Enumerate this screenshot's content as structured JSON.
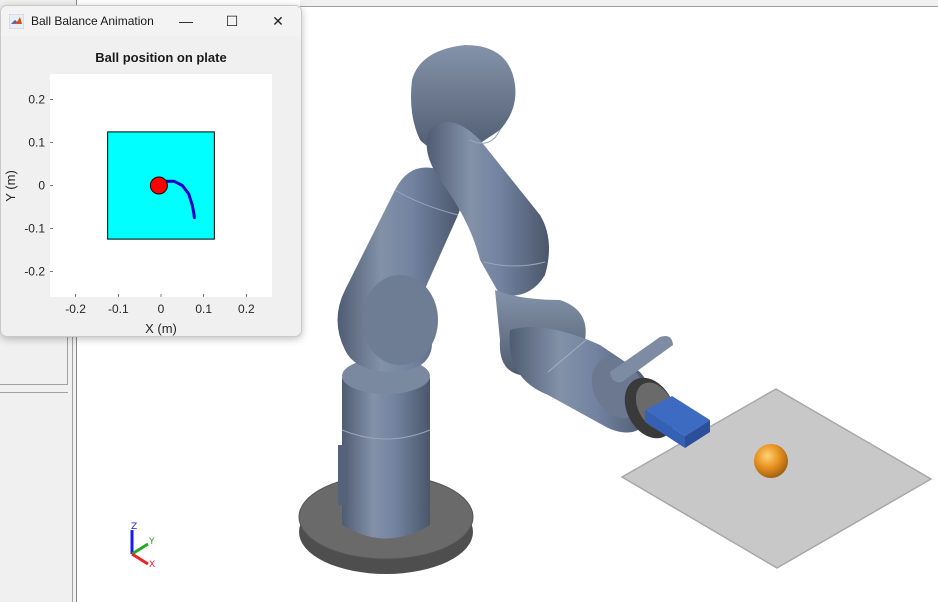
{
  "figure_window": {
    "title": "Ball Balance Animation",
    "icon": "matlab-icon",
    "controls": {
      "minimize": "—",
      "maximize": "☐",
      "close": "✕"
    }
  },
  "chart_data": {
    "type": "scatter",
    "title": "Ball position on plate",
    "xlabel": "X (m)",
    "ylabel": "Y (m)",
    "xlim": [
      -0.26,
      0.26
    ],
    "ylim": [
      -0.26,
      0.26
    ],
    "xticks": [
      -0.2,
      -0.1,
      0,
      0.1,
      0.2
    ],
    "yticks": [
      -0.2,
      -0.1,
      0,
      0.1,
      0.2
    ],
    "xtick_labels": [
      "-0.2",
      "-0.1",
      "0",
      "0.1",
      "0.2"
    ],
    "ytick_labels": [
      "-0.2",
      "-0.1",
      "0",
      "0.1",
      "0.2"
    ],
    "plate": {
      "x": [
        -0.125,
        0.125
      ],
      "y": [
        -0.125,
        0.125
      ],
      "color": "#00ffff"
    },
    "series": [
      {
        "x": [
          -0.005,
          0.01,
          0.03,
          0.05,
          0.065,
          0.073,
          0.077,
          0.078
        ],
        "y": [
          0.0,
          0.01,
          0.01,
          0.0,
          -0.02,
          -0.045,
          -0.065,
          -0.075
        ],
        "color": "#0000cc"
      }
    ],
    "ball": {
      "x": -0.005,
      "y": 0.0,
      "color": "#ff0000"
    },
    "grid": false
  },
  "triad": {
    "z": "Z",
    "y": "Y",
    "x": "X"
  },
  "colors": {
    "robot": "#6f7d94",
    "base": "#606060",
    "plate": "#c8c8c8",
    "ball": "#e8921f",
    "gripper": "#3e6bc2"
  }
}
